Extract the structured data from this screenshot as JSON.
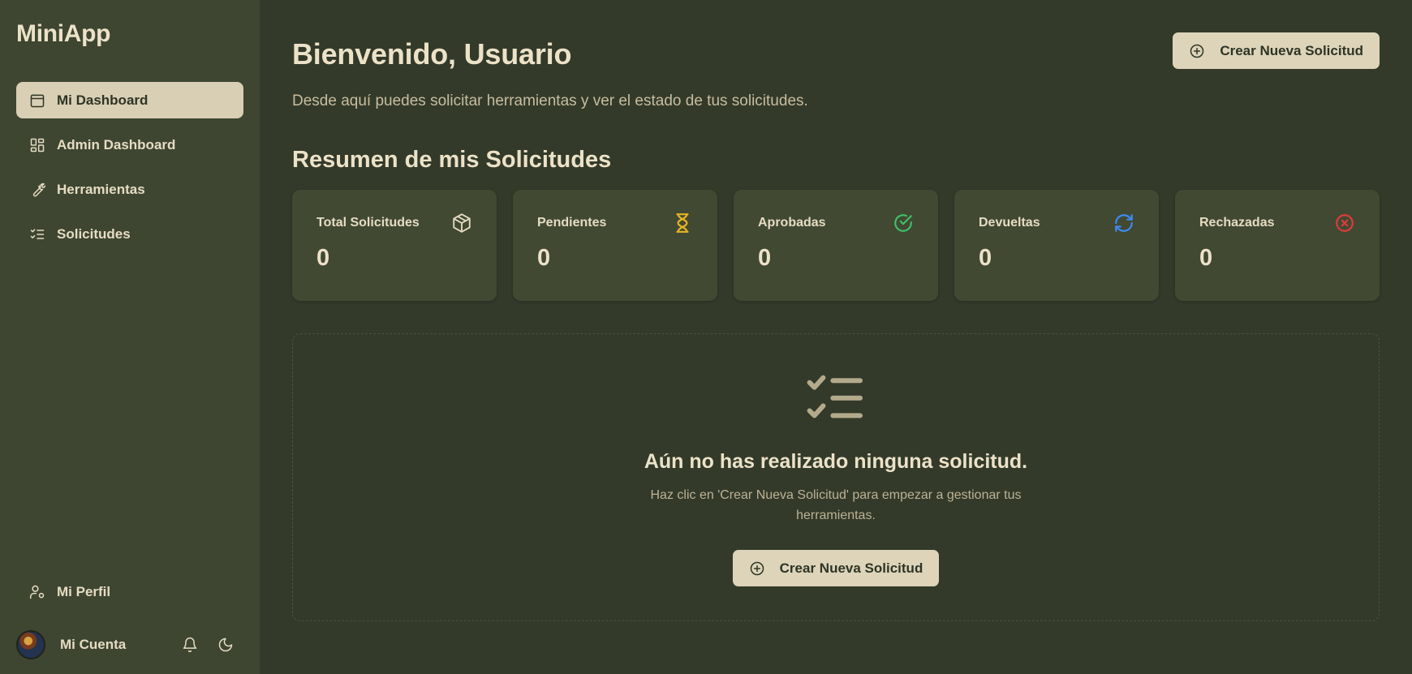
{
  "app": {
    "title": "MiniApp"
  },
  "sidebar": {
    "items": [
      {
        "label": "Mi Dashboard",
        "icon": "calendar-icon",
        "active": true
      },
      {
        "label": "Admin Dashboard",
        "icon": "layout-grid-icon",
        "active": false
      },
      {
        "label": "Herramientas",
        "icon": "wrench-icon",
        "active": false
      },
      {
        "label": "Solicitudes",
        "icon": "list-checks-icon",
        "active": false
      }
    ],
    "profile_label": "Mi Perfil",
    "account_label": "Mi Cuenta",
    "icons": [
      "user-cog-icon",
      "bell-icon",
      "moon-icon"
    ]
  },
  "header": {
    "title": "Bienvenido, Usuario",
    "create_button": "Crear Nueva Solicitud",
    "subtitle": "Desde aquí puedes solicitar herramientas y ver el estado de tus solicitudes."
  },
  "summary": {
    "title": "Resumen de mis Solicitudes",
    "cards": [
      {
        "label": "Total Solicitudes",
        "value": "0",
        "icon": "box-icon",
        "color": "#e6dcc2"
      },
      {
        "label": "Pendientes",
        "value": "0",
        "icon": "hourglass-icon",
        "color": "#e6b422"
      },
      {
        "label": "Aprobadas",
        "value": "0",
        "icon": "check-circle-icon",
        "color": "#3fbf6a"
      },
      {
        "label": "Devueltas",
        "value": "0",
        "icon": "refresh-icon",
        "color": "#3d8bf2"
      },
      {
        "label": "Rechazadas",
        "value": "0",
        "icon": "x-circle-icon",
        "color": "#e03b3b"
      }
    ]
  },
  "empty_state": {
    "icon": "list-checks-icon",
    "title": "Aún no has realizado ninguna solicitud.",
    "description": "Haz clic en 'Crear Nueva Solicitud' para empezar a gestionar tus herramientas.",
    "button": "Crear Nueva Solicitud"
  },
  "colors": {
    "sidebar_bg": "#3e4632",
    "main_bg": "#333a2a",
    "card_bg": "#414932",
    "accent": "#ddd4ba",
    "text": "#e6dcc2"
  }
}
